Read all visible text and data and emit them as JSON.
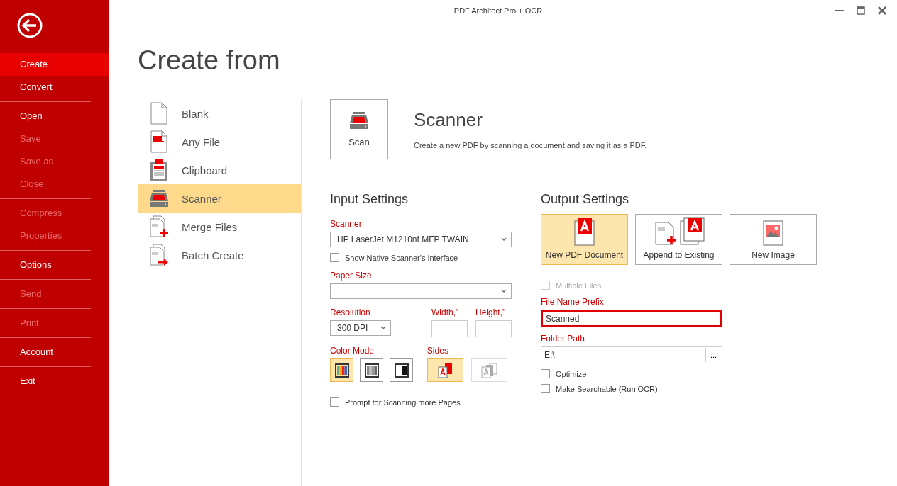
{
  "window": {
    "title": "PDF Architect Pro + OCR"
  },
  "sidebar": {
    "groups": [
      [
        {
          "label": "Create",
          "selected": true,
          "disabled": false
        },
        {
          "label": "Convert",
          "selected": false,
          "disabled": false
        }
      ],
      [
        {
          "label": "Open",
          "selected": false,
          "disabled": false
        },
        {
          "label": "Save",
          "selected": false,
          "disabled": true
        },
        {
          "label": "Save as",
          "selected": false,
          "disabled": true
        },
        {
          "label": "Close",
          "selected": false,
          "disabled": true
        }
      ],
      [
        {
          "label": "Compress",
          "selected": false,
          "disabled": true
        },
        {
          "label": "Properties",
          "selected": false,
          "disabled": true
        }
      ],
      [
        {
          "label": "Options",
          "selected": false,
          "disabled": false
        }
      ],
      [
        {
          "label": "Send",
          "selected": false,
          "disabled": true
        }
      ],
      [
        {
          "label": "Print",
          "selected": false,
          "disabled": true
        }
      ],
      [
        {
          "label": "Account",
          "selected": false,
          "disabled": false
        }
      ],
      [
        {
          "label": "Exit",
          "selected": false,
          "disabled": false
        }
      ]
    ]
  },
  "page_title": "Create from",
  "sources": [
    {
      "label": "Blank",
      "kind": "blank",
      "selected": false
    },
    {
      "label": "Any File",
      "kind": "file",
      "selected": false
    },
    {
      "label": "Clipboard",
      "kind": "clipboard",
      "selected": false
    },
    {
      "label": "Scanner",
      "kind": "scanner",
      "selected": true
    },
    {
      "label": "Merge Files",
      "kind": "merge",
      "selected": false
    },
    {
      "label": "Batch Create",
      "kind": "batch",
      "selected": false
    }
  ],
  "action": {
    "button": "Scan",
    "title": "Scanner",
    "description": "Create a new PDF by scanning a document and saving it as a PDF."
  },
  "input_settings": {
    "title": "Input Settings",
    "scanner": {
      "label": "Scanner",
      "value": "HP LaserJet M1210nf MFP TWAIN"
    },
    "show_native": {
      "label": "Show Native Scanner's Interface",
      "checked": false
    },
    "paper_size": {
      "label": "Paper Size"
    },
    "resolution": {
      "label": "Resolution",
      "value": "300 DPI"
    },
    "width": {
      "label": "Width,\""
    },
    "height": {
      "label": "Height,\""
    },
    "color_mode": {
      "label": "Color Mode",
      "options": [
        {
          "kind": "color",
          "selected": true
        },
        {
          "kind": "gray",
          "selected": false
        },
        {
          "kind": "bw",
          "selected": false
        }
      ]
    },
    "sides": {
      "label": "Sides",
      "options": [
        {
          "kind": "single",
          "selected": true,
          "disabled": false
        },
        {
          "kind": "double",
          "selected": false,
          "disabled": true
        }
      ]
    },
    "prompt": {
      "label": "Prompt for Scanning more Pages",
      "checked": false
    }
  },
  "output_settings": {
    "title": "Output Settings",
    "options": [
      {
        "label": "New PDF Document",
        "kind": "pdf",
        "selected": true
      },
      {
        "label": "Append to Existing",
        "kind": "append",
        "selected": false
      },
      {
        "label": "New Image",
        "kind": "image",
        "selected": false
      }
    ],
    "multiple_files": {
      "label": "Multiple Files",
      "checked": false,
      "disabled": true
    },
    "prefix": {
      "label": "File Name Prefix",
      "value": "Scanned",
      "focused": true
    },
    "folder": {
      "label": "Folder Path",
      "value": "E:\\",
      "button": "..."
    },
    "optimize": {
      "label": "Optimize",
      "checked": false
    },
    "searchable": {
      "label": "Make Searchable (Run OCR)",
      "checked": false
    }
  }
}
